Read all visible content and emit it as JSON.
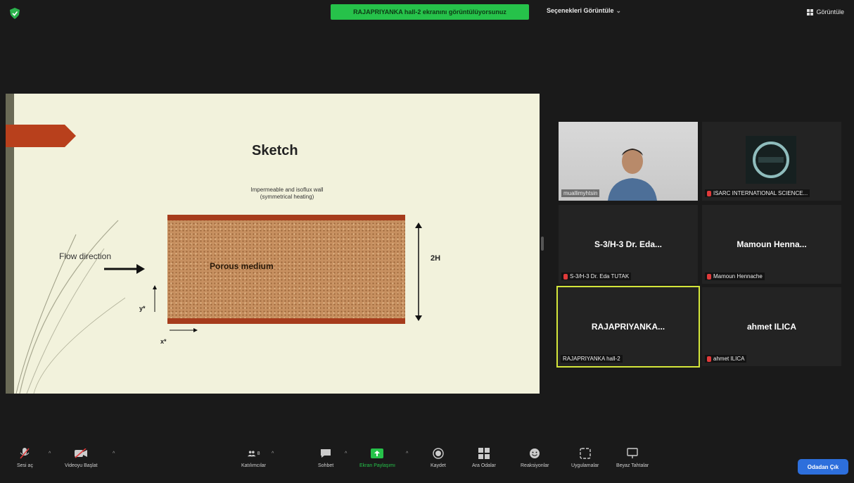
{
  "header": {
    "share_banner": "RAJAPRIYANKA hall-2 ekranını görüntülüyorsunuz",
    "view_options": "Seçenekleri Görüntüle",
    "view_button": "Görüntüle"
  },
  "slide": {
    "title": "Sketch",
    "wall_label_1": "Impermeable and isoflux wall",
    "wall_label_2": "(symmetrical heating)",
    "porous_label": "Porous medium",
    "flow_label": "Flow direction",
    "height_label": "2H",
    "y_label": "y*",
    "x_label": "x*"
  },
  "participants": [
    {
      "center_name": "",
      "label": "muallimyhtsin",
      "muted": false,
      "video": true
    },
    {
      "center_name": "",
      "label": "ISARC INTERNATIONAL SCIENCE...",
      "muted": true,
      "logo": true
    },
    {
      "center_name": "S-3/H-3  Dr. Eda...",
      "label": "S-3/H-3 Dr. Eda TUTAK",
      "muted": true
    },
    {
      "center_name": "Mamoun  Henna...",
      "label": "Mamoun Hennache",
      "muted": true
    },
    {
      "center_name": "RAJAPRIYANKA...",
      "label": "RAJAPRIYANKA hall-2",
      "muted": false,
      "active": true
    },
    {
      "center_name": "ahmet ILICA",
      "label": "ahmet ILICA",
      "muted": true
    }
  ],
  "toolbar": {
    "audio": "Sesi aç",
    "video": "Videoyu Başlat",
    "participants": "Katılımcılar",
    "participants_count": "8",
    "chat": "Sohbet",
    "share": "Ekran Paylaşımı",
    "record": "Kaydet",
    "breakout": "Ara Odalar",
    "reactions": "Reaksiyonlar",
    "apps": "Uygulamalar",
    "whiteboard": "Beyaz Tahtalar",
    "leave": "Odadan Çık"
  },
  "colors": {
    "share_green": "#26c24a",
    "active_border": "#d4e63a",
    "leave_blue": "#2d6fdc",
    "wall_red": "#a63c1c"
  }
}
